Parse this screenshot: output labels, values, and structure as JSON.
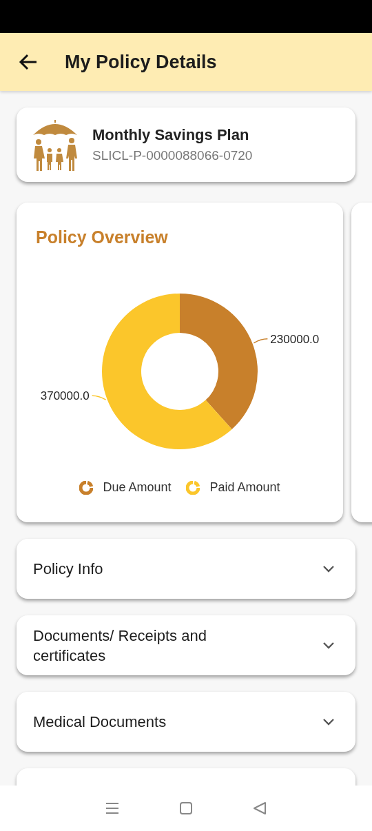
{
  "header": {
    "title": "My Policy Details"
  },
  "policy": {
    "name": "Monthly Savings Plan",
    "number": "SLICL-P-0000088066-0720"
  },
  "overview": {
    "title": "Policy Overview",
    "slices": [
      {
        "color": "#c8802b"
      },
      {
        "color": "#fbc62b"
      }
    ],
    "chart_data": {
      "type": "donut",
      "categories": [
        "Due Amount",
        "Paid Amount"
      ],
      "values": [
        230000,
        370000
      ],
      "value_labels": [
        "230000.0",
        "370000.0"
      ]
    }
  },
  "sections": [
    {
      "label": "Policy Info",
      "expanded": false
    },
    {
      "label": "Documents/ Receipts and certificates",
      "expanded": false
    },
    {
      "label": "Medical Documents",
      "expanded": false
    }
  ]
}
